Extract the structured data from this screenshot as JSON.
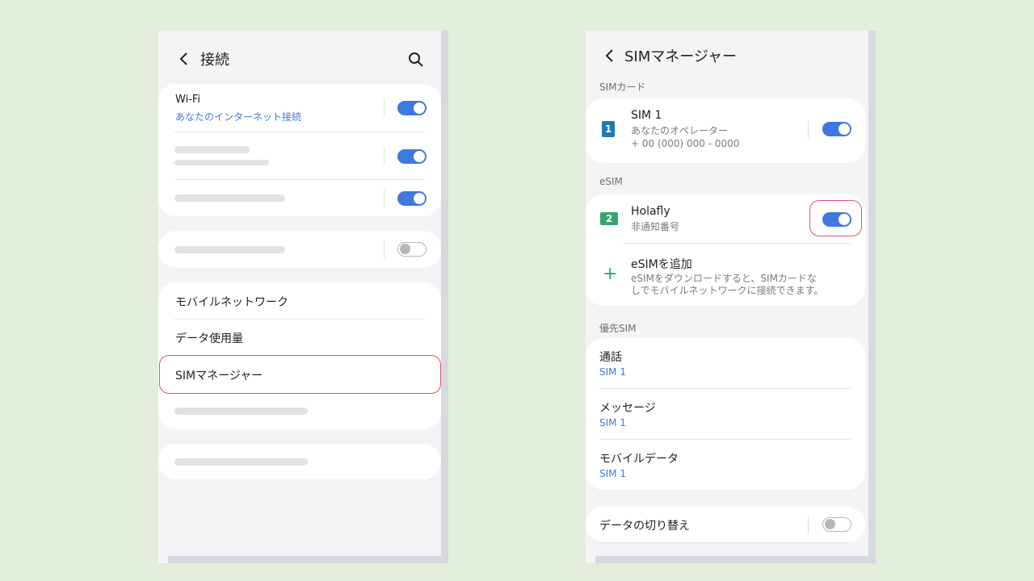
{
  "left_screen": {
    "title": "接続",
    "wifi": {
      "label": "Wi-Fi",
      "sub": "あなたのインターネット接続",
      "toggle": "on"
    },
    "toggles": [
      "on",
      "on",
      "off"
    ],
    "menu": [
      {
        "label": "モバイルネットワーク"
      },
      {
        "label": "データ使用量"
      },
      {
        "label": "SIMマネージャー"
      }
    ],
    "highlighted_item": "SIMマネージャー",
    "icons": {
      "back": "chevron-left-icon",
      "search": "search-icon"
    }
  },
  "right_screen": {
    "title": "SIMマネージャー",
    "sim_section": "SIMカード",
    "sim1": {
      "icon_text": "1",
      "icon_color": "#1f79b4",
      "name": "SIM 1",
      "operator": "あなたのオペレーター",
      "number": "+ 00 (000) 000 - 0000",
      "toggle": "on"
    },
    "esim_section": "eSIM",
    "esim": {
      "icon_text": "2",
      "icon_color": "#35a56e",
      "name": "Holafly",
      "number": "非通知番号",
      "toggle": "on"
    },
    "add_esim": {
      "label": "eSIMを追加",
      "desc_line1": "eSIMをダウンロードすると、SIMカードな",
      "desc_line2": "しでモバイルネットワークに接続できます。"
    },
    "preferred_section": "優先SIM",
    "preferred": [
      {
        "label": "通話",
        "value": "SIM 1"
      },
      {
        "label": "メッセージ",
        "value": "SIM 1"
      },
      {
        "label": "モバイルデータ",
        "value": "SIM 1"
      }
    ],
    "data_switch": {
      "label": "データの切り替え",
      "toggle": "off"
    }
  },
  "colors": {
    "accent": "#3e78e0",
    "highlight": "#e05070",
    "background": "#e3eedb",
    "esim_green": "#35a56e"
  }
}
